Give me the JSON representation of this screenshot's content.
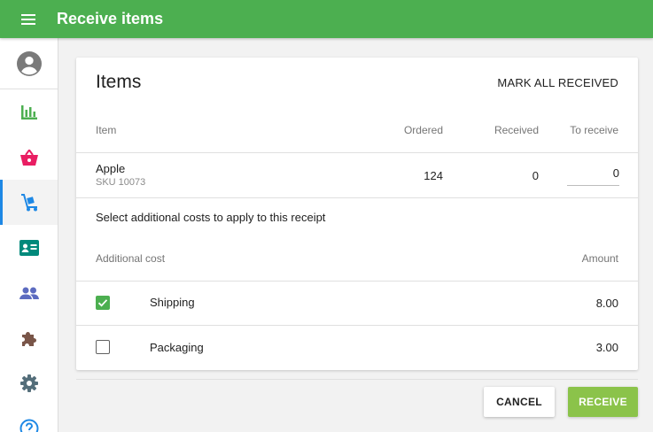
{
  "app": {
    "title": "Receive items"
  },
  "sidebar": {
    "items": [
      {
        "icon": "account-icon",
        "color": "#757575"
      },
      {
        "icon": "reports-icon",
        "color": "#4caf50"
      },
      {
        "icon": "basket-icon",
        "color": "#e91e63"
      },
      {
        "icon": "inventory-icon",
        "color": "#1e88e5",
        "active": true
      },
      {
        "icon": "customers-icon",
        "color": "#00897b"
      },
      {
        "icon": "employees-icon",
        "color": "#5c6bc0"
      },
      {
        "icon": "integrations-icon",
        "color": "#795548"
      },
      {
        "icon": "settings-icon",
        "color": "#546e7a"
      },
      {
        "icon": "help-icon",
        "color": "#1e88e5"
      }
    ]
  },
  "card": {
    "title": "Items",
    "mark_all": "MARK ALL RECEIVED",
    "columns": {
      "item": "Item",
      "ordered": "Ordered",
      "received": "Received",
      "to_receive": "To receive"
    },
    "rows": [
      {
        "name": "Apple",
        "sku": "SKU 10073",
        "ordered": "124",
        "received": "0",
        "to_receive": "0"
      }
    ],
    "additional_prompt": "Select additional costs to apply to this receipt",
    "cost_columns": {
      "cost": "Additional cost",
      "amount": "Amount"
    },
    "costs": [
      {
        "name": "Shipping",
        "amount": "8.00",
        "checked": true
      },
      {
        "name": "Packaging",
        "amount": "3.00",
        "checked": false
      }
    ]
  },
  "actions": {
    "cancel": "CANCEL",
    "receive": "RECEIVE"
  },
  "colors": {
    "appbar": "#4caf50",
    "receive_button": "#8bc34a",
    "checkbox": "#4caf50"
  }
}
